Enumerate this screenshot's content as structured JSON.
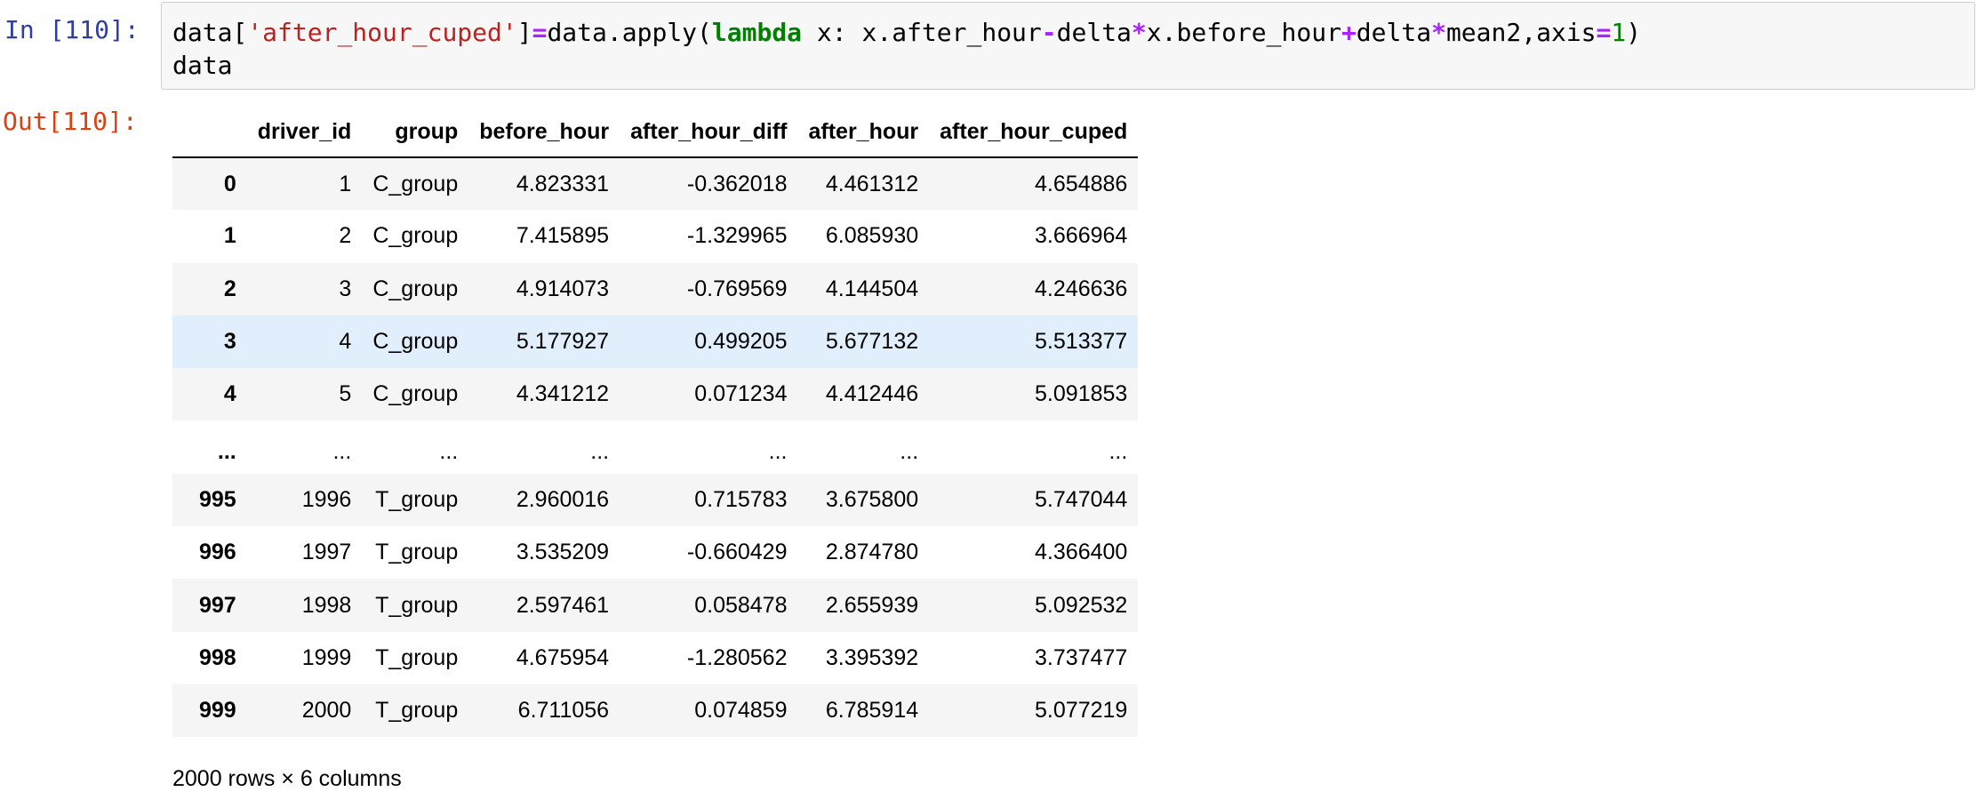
{
  "input_cell": {
    "prompt": "In [110]:",
    "code_line1": [
      {
        "type": "plain",
        "text": "data["
      },
      {
        "type": "str",
        "text": "'after_hour_cuped'"
      },
      {
        "type": "plain",
        "text": "]"
      },
      {
        "type": "op",
        "text": "="
      },
      {
        "type": "plain",
        "text": "data.apply("
      },
      {
        "type": "kw",
        "text": "lambda"
      },
      {
        "type": "plain",
        "text": " x: x.after_hour"
      },
      {
        "type": "op",
        "text": "-"
      },
      {
        "type": "plain",
        "text": "delta"
      },
      {
        "type": "op",
        "text": "*"
      },
      {
        "type": "plain",
        "text": "x.before_hour"
      },
      {
        "type": "op",
        "text": "+"
      },
      {
        "type": "plain",
        "text": "delta"
      },
      {
        "type": "op",
        "text": "*"
      },
      {
        "type": "plain",
        "text": "mean2,axis"
      },
      {
        "type": "op",
        "text": "="
      },
      {
        "type": "num",
        "text": "1"
      },
      {
        "type": "plain",
        "text": ")"
      }
    ],
    "code_line2": "data"
  },
  "output_cell": {
    "prompt": "Out[110]:",
    "columns": [
      "",
      "driver_id",
      "group",
      "before_hour",
      "after_hour_diff",
      "after_hour",
      "after_hour_cuped"
    ],
    "rows": [
      {
        "index": "0",
        "driver_id": "1",
        "group": "C_group",
        "before_hour": "4.823331",
        "after_hour_diff": "-0.362018",
        "after_hour": "4.461312",
        "after_hour_cuped": "4.654886"
      },
      {
        "index": "1",
        "driver_id": "2",
        "group": "C_group",
        "before_hour": "7.415895",
        "after_hour_diff": "-1.329965",
        "after_hour": "6.085930",
        "after_hour_cuped": "3.666964"
      },
      {
        "index": "2",
        "driver_id": "3",
        "group": "C_group",
        "before_hour": "4.914073",
        "after_hour_diff": "-0.769569",
        "after_hour": "4.144504",
        "after_hour_cuped": "4.246636"
      },
      {
        "index": "3",
        "driver_id": "4",
        "group": "C_group",
        "before_hour": "5.177927",
        "after_hour_diff": "0.499205",
        "after_hour": "5.677132",
        "after_hour_cuped": "5.513377"
      },
      {
        "index": "4",
        "driver_id": "5",
        "group": "C_group",
        "before_hour": "4.341212",
        "after_hour_diff": "0.071234",
        "after_hour": "4.412446",
        "after_hour_cuped": "5.091853"
      },
      {
        "index": "...",
        "driver_id": "...",
        "group": "...",
        "before_hour": "...",
        "after_hour_diff": "...",
        "after_hour": "...",
        "after_hour_cuped": "..."
      },
      {
        "index": "995",
        "driver_id": "1996",
        "group": "T_group",
        "before_hour": "2.960016",
        "after_hour_diff": "0.715783",
        "after_hour": "3.675800",
        "after_hour_cuped": "5.747044"
      },
      {
        "index": "996",
        "driver_id": "1997",
        "group": "T_group",
        "before_hour": "3.535209",
        "after_hour_diff": "-0.660429",
        "after_hour": "2.874780",
        "after_hour_cuped": "4.366400"
      },
      {
        "index": "997",
        "driver_id": "1998",
        "group": "T_group",
        "before_hour": "2.597461",
        "after_hour_diff": "0.058478",
        "after_hour": "2.655939",
        "after_hour_cuped": "5.092532"
      },
      {
        "index": "998",
        "driver_id": "1999",
        "group": "T_group",
        "before_hour": "4.675954",
        "after_hour_diff": "-1.280562",
        "after_hour": "3.395392",
        "after_hour_cuped": "3.737477"
      },
      {
        "index": "999",
        "driver_id": "2000",
        "group": "T_group",
        "before_hour": "6.711056",
        "after_hour_diff": "0.074859",
        "after_hour": "6.785914",
        "after_hour_cuped": "5.077219"
      }
    ],
    "shape_caption": "2000 rows × 6 columns"
  },
  "colors": {
    "in_prompt": "#303f9f",
    "out_prompt": "#d84315",
    "string": "#ba2121",
    "keyword": "#008000",
    "operator": "#aa22ff",
    "number": "#008000",
    "row_stripe": "#f5f5f5",
    "row_hover": "#e1eefb",
    "code_bg": "#f7f7f7"
  }
}
